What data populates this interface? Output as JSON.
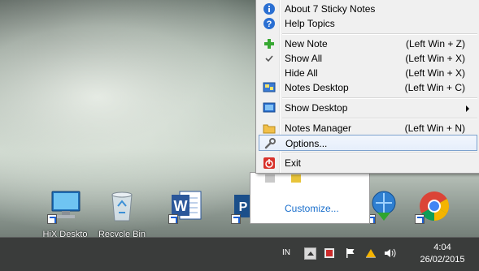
{
  "menu": {
    "items": [
      {
        "label": "About 7 Sticky Notes",
        "shortcut": "",
        "icon": "info-icon"
      },
      {
        "label": "Help Topics",
        "shortcut": "",
        "icon": "help-icon"
      },
      {
        "label": "New Note",
        "shortcut": "(Left Win + Z)",
        "icon": "plus-icon"
      },
      {
        "label": "Show All",
        "shortcut": "(Left Win + X)",
        "icon": "checkmark-icon"
      },
      {
        "label": "Hide All",
        "shortcut": "(Left Win + X)",
        "icon": ""
      },
      {
        "label": "Notes Desktop",
        "shortcut": "(Left Win + C)",
        "icon": "notes-desktop-icon"
      },
      {
        "label": "Show Desktop",
        "shortcut": "",
        "icon": "show-desktop-icon"
      },
      {
        "label": "Notes Manager",
        "shortcut": "(Left Win + N)",
        "icon": "folder-icon"
      },
      {
        "label": "Options...",
        "shortcut": "",
        "icon": "wrench-icon"
      },
      {
        "label": "Exit",
        "shortcut": "",
        "icon": "power-icon"
      }
    ]
  },
  "tray_flyout": {
    "customize_label": "Customize..."
  },
  "desktop_icons": [
    {
      "label": "HiX Deskto",
      "icon": "computer-icon"
    },
    {
      "label": "Recycle Bin",
      "icon": "recycle-bin-icon"
    },
    {
      "label": "",
      "icon": "word-icon"
    },
    {
      "label": "",
      "icon": "publisher-icon"
    },
    {
      "label": "",
      "icon": "download-manager-icon"
    },
    {
      "label": "",
      "icon": "chrome-icon"
    }
  ],
  "taskbar": {
    "language": "IN",
    "time": "4:04",
    "date": "26/02/2015"
  },
  "colors": {
    "menu_bg": "#f0f0f0",
    "highlight_border": "#7da2ce",
    "taskbar_bg": "#3a3c3b",
    "link": "#1a6fcc"
  }
}
